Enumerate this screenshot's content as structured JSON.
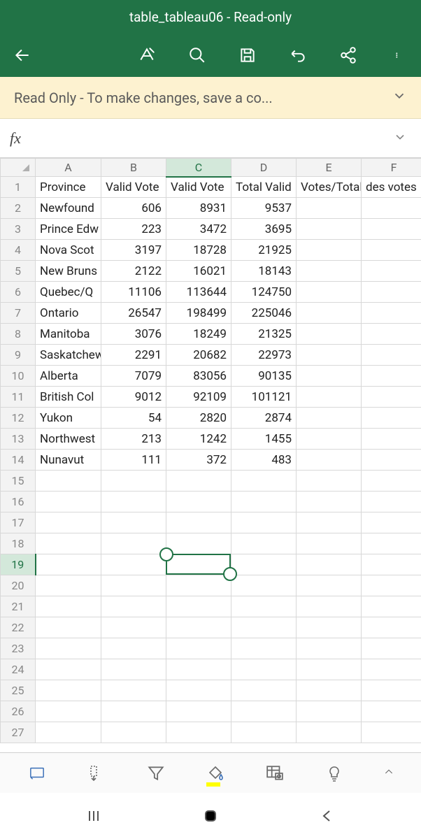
{
  "title": "table_tableau06 - Read-only",
  "banner": {
    "text": "Read Only - To make changes, save a co..."
  },
  "formula": {
    "fx": "fx",
    "value": ""
  },
  "columns": [
    "A",
    "B",
    "C",
    "D",
    "E",
    "F"
  ],
  "selectedCol": "C",
  "selectedRow": 19,
  "headers": {
    "A": "Province",
    "B": "Valid Vote",
    "C": "Valid Vote",
    "D": "Total Valid",
    "E": "Votes/Total",
    "F": "des votes"
  },
  "rows": [
    {
      "A": "Newfound",
      "B": "606",
      "C": "8931",
      "D": "9537"
    },
    {
      "A": "Prince Edw",
      "B": "223",
      "C": "3472",
      "D": "3695"
    },
    {
      "A": "Nova Scot",
      "B": "3197",
      "C": "18728",
      "D": "21925"
    },
    {
      "A": "New Bruns",
      "B": "2122",
      "C": "16021",
      "D": "18143"
    },
    {
      "A": "Quebec/Q",
      "B": "11106",
      "C": "113644",
      "D": "124750"
    },
    {
      "A": "Ontario",
      "B": "26547",
      "C": "198499",
      "D": "225046"
    },
    {
      "A": "Manitoba",
      "B": "3076",
      "C": "18249",
      "D": "21325"
    },
    {
      "A": "Saskatchew",
      "B": "2291",
      "C": "20682",
      "D": "22973"
    },
    {
      "A": "Alberta",
      "B": "7079",
      "C": "83056",
      "D": "90135"
    },
    {
      "A": "British Col",
      "B": "9012",
      "C": "92109",
      "D": "101121"
    },
    {
      "A": "Yukon",
      "B": "54",
      "C": "2820",
      "D": "2874"
    },
    {
      "A": "Northwest",
      "B": "213",
      "C": "1242",
      "D": "1455"
    },
    {
      "A": "Nunavut",
      "B": "111",
      "C": "372",
      "D": "483"
    }
  ],
  "emptyRowsFrom": 15,
  "emptyRowsTo": 27
}
